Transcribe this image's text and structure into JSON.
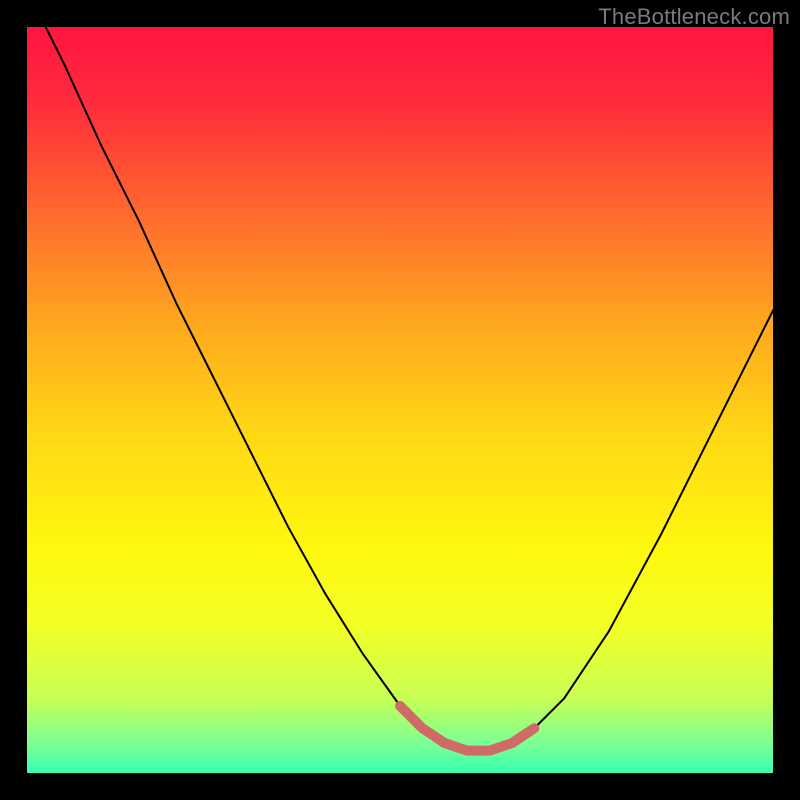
{
  "watermark": "TheBottleneck.com",
  "colors": {
    "frame": "#000000",
    "watermark": "#7a7a7a",
    "curve": "#000000",
    "highlight": "#cf6a67",
    "gradient_stops": [
      {
        "offset": 0.0,
        "color": "#ff153f"
      },
      {
        "offset": 0.1,
        "color": "#ff2b3d"
      },
      {
        "offset": 0.25,
        "color": "#ff6a2d"
      },
      {
        "offset": 0.4,
        "color": "#ffa81f"
      },
      {
        "offset": 0.55,
        "color": "#ffd914"
      },
      {
        "offset": 0.7,
        "color": "#fff80e"
      },
      {
        "offset": 0.8,
        "color": "#f3ff24"
      },
      {
        "offset": 0.9,
        "color": "#c7ff55"
      },
      {
        "offset": 0.96,
        "color": "#7dff93"
      },
      {
        "offset": 1.0,
        "color": "#35ffb0"
      }
    ]
  },
  "chart_data": {
    "type": "line",
    "title": "",
    "xlabel": "",
    "ylabel": "",
    "xlim": [
      0,
      100
    ],
    "ylim": [
      0,
      100
    ],
    "series": [
      {
        "name": "bottleneck-curve",
        "x": [
          0,
          5,
          10,
          15,
          20,
          25,
          30,
          35,
          40,
          45,
          50,
          53,
          56,
          59,
          62,
          65,
          68,
          72,
          78,
          85,
          92,
          100
        ],
        "values": [
          105,
          95,
          84,
          74,
          63,
          53,
          43,
          33,
          24,
          16,
          9,
          6,
          4,
          3,
          3,
          4,
          6,
          10,
          19,
          32,
          46,
          62
        ]
      }
    ],
    "highlight": {
      "name": "optimal-range",
      "x": [
        50,
        53,
        56,
        59,
        62,
        65,
        68
      ],
      "values": [
        9,
        6,
        4,
        3,
        3,
        4,
        6
      ]
    }
  }
}
